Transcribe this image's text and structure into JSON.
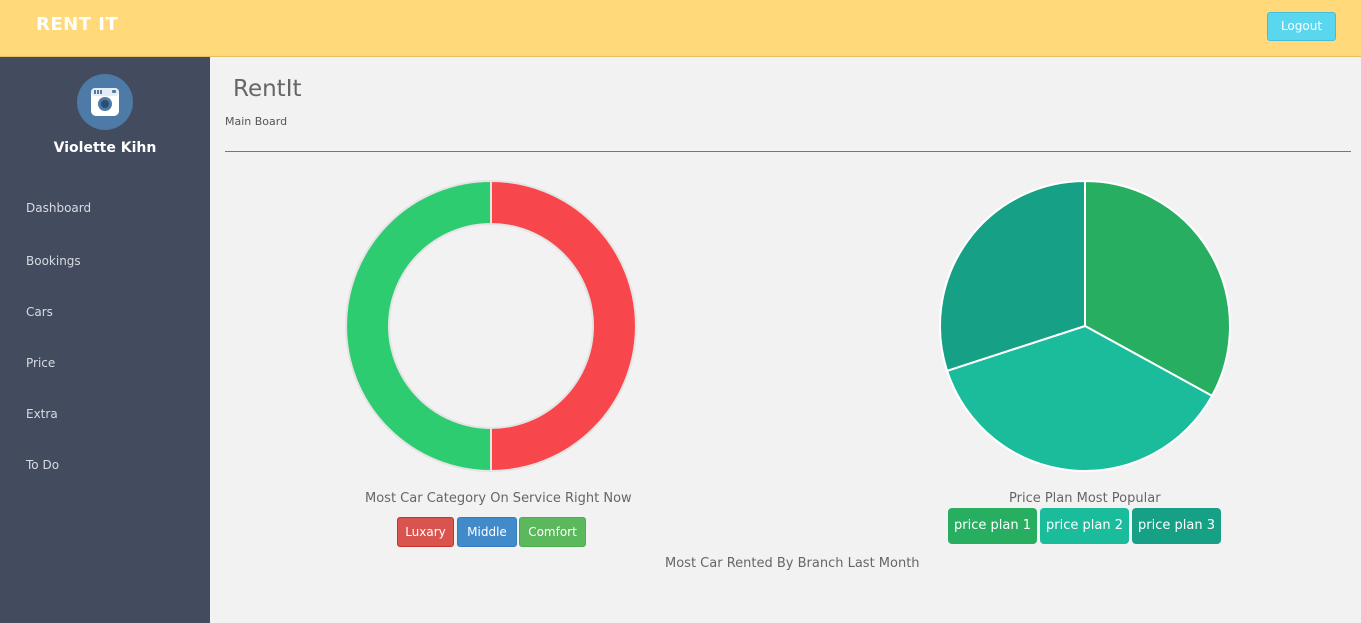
{
  "header": {
    "brand": "RENT IT",
    "logout_label": "Logout"
  },
  "sidebar": {
    "user_name": "Violette Kihn",
    "items": [
      {
        "label": "Dashboard"
      },
      {
        "label": "Bookings"
      },
      {
        "label": "Cars"
      },
      {
        "label": "Price"
      },
      {
        "label": "Extra"
      },
      {
        "label": "To Do"
      }
    ]
  },
  "main": {
    "title": "RentIt",
    "breadcrumb": "Main Board"
  },
  "car_category_chart": {
    "caption": "Most Car Category On Service Right Now",
    "legend": [
      {
        "label": "Luxary",
        "color": "#d9534f"
      },
      {
        "label": "Middle",
        "color": "#428bca"
      },
      {
        "label": "Comfort",
        "color": "#5cb85c"
      }
    ]
  },
  "price_plan_chart": {
    "caption": "Price Plan Most Popular",
    "legend": [
      {
        "label": "price plan 1",
        "color": "#27ae60"
      },
      {
        "label": "price plan 2",
        "color": "#1abc9c"
      },
      {
        "label": "price plan 3",
        "color": "#16a085"
      }
    ]
  },
  "branch_caption": "Most Car Rented By Branch Last Month",
  "chart_data": [
    {
      "type": "pie",
      "variant": "doughnut",
      "categories": [
        "Luxary",
        "Middle",
        "Comfort"
      ],
      "values": [
        50,
        0,
        50
      ],
      "colors": [
        "#f8474c",
        "#428bca",
        "#2ecc71"
      ],
      "title": "Most Car Category On Service Right Now"
    },
    {
      "type": "pie",
      "categories": [
        "price plan 1",
        "price plan 2",
        "price plan 3"
      ],
      "values": [
        33,
        37,
        30
      ],
      "colors": [
        "#27ae60",
        "#1abc9c",
        "#16a085"
      ],
      "title": "Price Plan Most Popular"
    }
  ]
}
